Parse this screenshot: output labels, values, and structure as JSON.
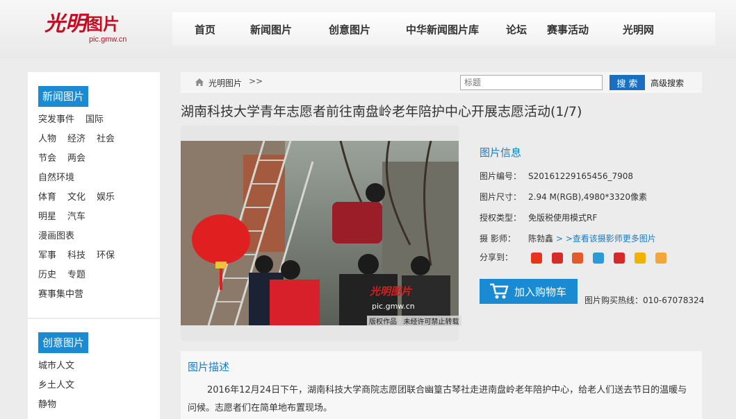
{
  "header": {
    "logo_text": "光明图片",
    "logo_domain": "pic.gmw.cn",
    "nav": [
      "首页",
      "新闻图片",
      "创意图片",
      "中华新闻图片库",
      "论坛",
      "赛事活动",
      "光明网"
    ]
  },
  "sidebar": {
    "news_title": "新闻图片",
    "news_rows": [
      [
        "突发事件",
        "国际"
      ],
      [
        "人物",
        "经济",
        "社会"
      ],
      [
        "节会",
        "两会"
      ],
      [
        "自然环境"
      ],
      [
        "体育",
        "文化",
        "娱乐"
      ],
      [
        "明星",
        "汽车"
      ],
      [
        "漫画图表"
      ],
      [
        "军事",
        "科技",
        "环保"
      ],
      [
        "历史",
        "专题"
      ],
      [
        "赛事集中营"
      ]
    ],
    "creative_title": "创意图片",
    "creative_rows": [
      [
        "城市人文"
      ],
      [
        "乡土人文"
      ],
      [
        "静物"
      ]
    ]
  },
  "breadcrumb": {
    "home": "光明图片",
    "arrows": ">>"
  },
  "search": {
    "placeholder": "标题",
    "button": "搜 索",
    "advanced": "高级搜索"
  },
  "page_title": "湖南科技大学青年志愿者前往南盘岭老年陪护中心开展志愿活动(1/7)",
  "photo": {
    "watermark_logo": "光明图片",
    "watermark_domain": "pic.gmw.cn",
    "notice": "版权作品   未经许可禁止转载"
  },
  "info": {
    "heading": "图片信息",
    "id_label": "图片编号：",
    "id_value": "S20161229165456_7908",
    "size_label": "图片尺寸：",
    "size_value": "2.94 M(RGB),4980*3320像素",
    "license_label": "授权类型：",
    "license_value": "免版税使用模式RF",
    "photographer_label": "摄 影师：",
    "photographer_value": "陈勃鑫",
    "photographer_link": "> >查看该摄影师更多图片",
    "share_label": "分享到：",
    "share_colors": [
      "#e8341c",
      "#d62b26",
      "#e35a2b",
      "#2b9ad6",
      "#d7282a",
      "#f0b400",
      "#f3a73a"
    ],
    "cart_button": "加入购物车",
    "hotline": "图片购买热线：010-67078324"
  },
  "description": {
    "heading": "图片描述",
    "text": "2016年12月24日下午，湖南科技大学商院志愿团联合幽篁古琴社走进南盘岭老年陪护中心，给老人们送去节日的温暖与问候。志愿者们在简单地布置现场。"
  }
}
